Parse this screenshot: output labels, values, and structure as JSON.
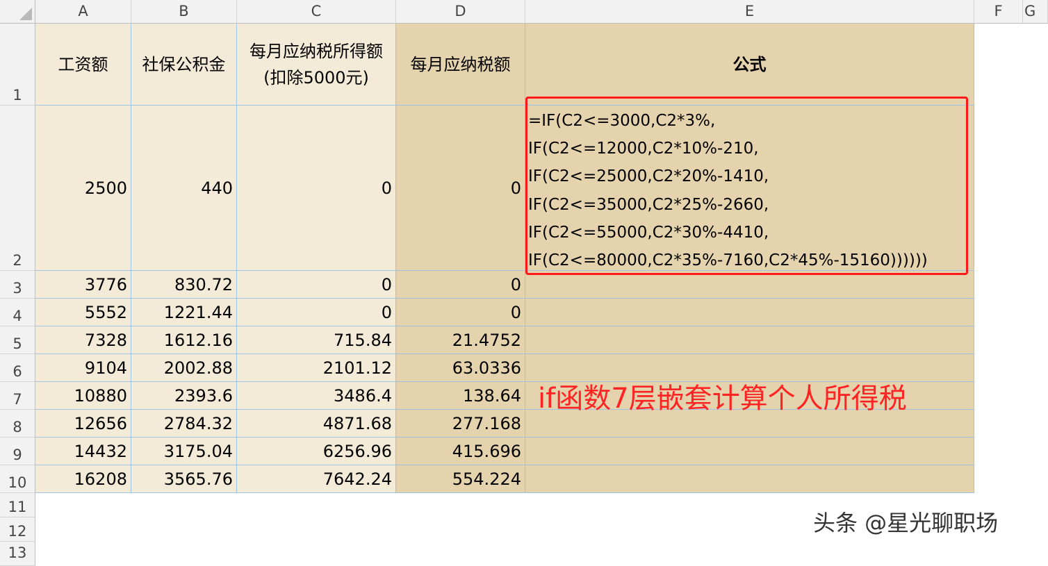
{
  "columns": [
    "A",
    "B",
    "C",
    "D",
    "E",
    "F",
    "G"
  ],
  "rows": [
    "1",
    "2",
    "3",
    "4",
    "5",
    "6",
    "7",
    "8",
    "9",
    "10",
    "11",
    "12",
    "13"
  ],
  "header": {
    "salary": "工资额",
    "social": "社保公积金",
    "taxable_line1": "每月应纳税所得额",
    "taxable_line2": "(扣除5000元)",
    "tax": "每月应纳税额",
    "formula": "公式"
  },
  "data_rows": [
    {
      "salary": "2500",
      "social": "440",
      "taxable": "0",
      "tax": "0"
    },
    {
      "salary": "3776",
      "social": "830.72",
      "taxable": "0",
      "tax": "0"
    },
    {
      "salary": "5552",
      "social": "1221.44",
      "taxable": "0",
      "tax": "0"
    },
    {
      "salary": "7328",
      "social": "1612.16",
      "taxable": "715.84",
      "tax": "21.4752"
    },
    {
      "salary": "9104",
      "social": "2002.88",
      "taxable": "2101.12",
      "tax": "63.0336"
    },
    {
      "salary": "10880",
      "social": "2393.6",
      "taxable": "3486.4",
      "tax": "138.64"
    },
    {
      "salary": "12656",
      "social": "2784.32",
      "taxable": "4871.68",
      "tax": "277.168"
    },
    {
      "salary": "14432",
      "social": "3175.04",
      "taxable": "6256.96",
      "tax": "415.696"
    },
    {
      "salary": "16208",
      "social": "3565.76",
      "taxable": "7642.24",
      "tax": "554.224"
    }
  ],
  "formula_lines": [
    "=IF(C2<=3000,C2*3%,",
    "IF(C2<=12000,C2*10%-210,",
    "IF(C2<=25000,C2*20%-1410,",
    "IF(C2<=35000,C2*25%-2660,",
    "IF(C2<=55000,C2*30%-4410,",
    "IF(C2<=80000,C2*35%-7160,C2*45%-15160))))))"
  ],
  "annotation": "if函数7层嵌套计算个人所得税",
  "watermark": "头条 @星光聊职场",
  "colors": {
    "light_fill": "#f3ebd8",
    "dark_fill": "#e5d3ad",
    "highlight_border": "#ff1a1a",
    "annotation_text": "#ff2323"
  }
}
